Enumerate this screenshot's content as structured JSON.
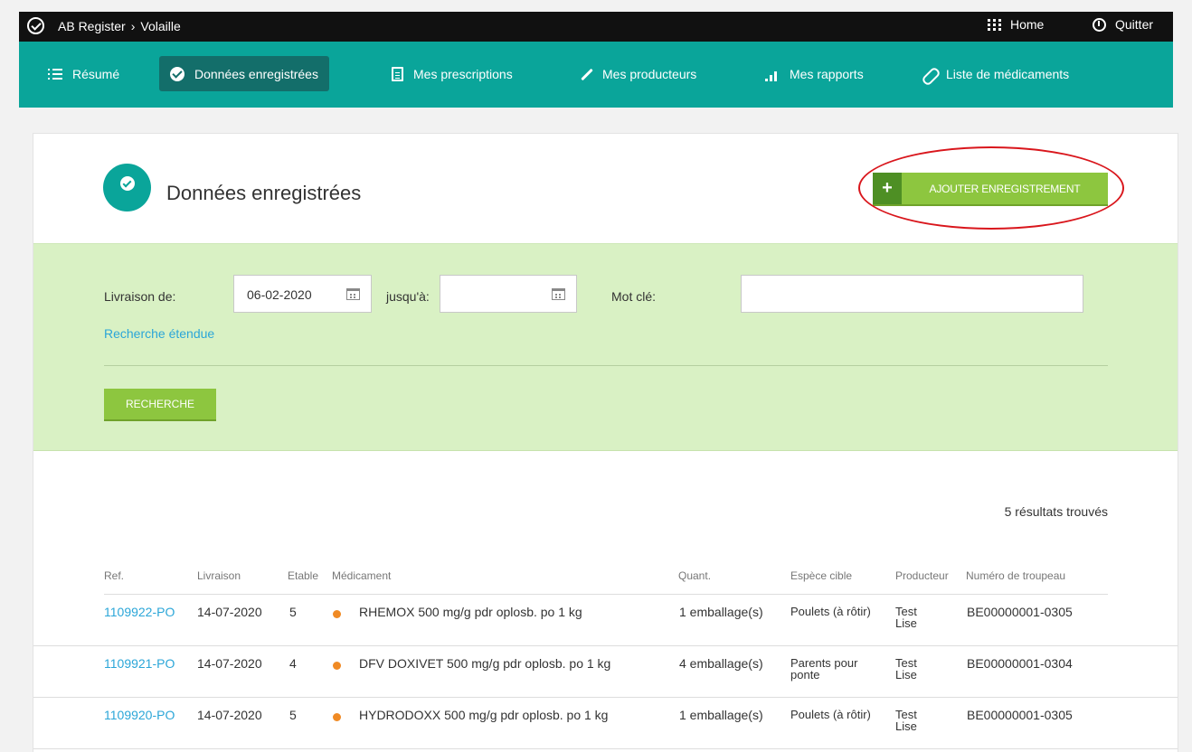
{
  "topbar": {
    "breadcrumb_app": "AB Register",
    "breadcrumb_separator": "›",
    "breadcrumb_page": "Volaille",
    "home_label": "Home",
    "quit_label": "Quitter"
  },
  "nav": {
    "items": [
      {
        "label": "Résumé",
        "icon": "list-icon"
      },
      {
        "label": "Données enregistrées",
        "icon": "check-circle-icon",
        "active": true
      },
      {
        "label": "Mes prescriptions",
        "icon": "document-icon"
      },
      {
        "label": "Mes producteurs",
        "icon": "syringe-icon"
      },
      {
        "label": "Mes rapports",
        "icon": "bar-chart-icon"
      },
      {
        "label": "Liste de médicaments",
        "icon": "pill-icon"
      }
    ]
  },
  "page": {
    "title": "Données enregistrées",
    "add_button_label": "AJOUTER ENREGISTREMENT",
    "add_button_icon": "+"
  },
  "filter": {
    "delivery_from_label": "Livraison de:",
    "delivery_from_value": "06-02-2020",
    "until_label": "jusqu'à:",
    "until_value": "",
    "keyword_label": "Mot clé:",
    "keyword_value": "",
    "extended_search_label": "Recherche étendue",
    "search_button_label": "RECHERCHE"
  },
  "results": {
    "count_text": "5 résultats trouvés",
    "columns": [
      "Ref.",
      "Livraison",
      "Etable",
      "Médicament",
      "Quant.",
      "Espèce cible",
      "Producteur",
      "Numéro de troupeau"
    ],
    "rows": [
      {
        "ref": "1109922-PO",
        "livraison": "14-07-2020",
        "etable": "5",
        "medicament": "RHEMOX 500 mg/g pdr oplosb. po 1 kg",
        "quant": "1 emballage(s)",
        "espece": "Poulets (à rôtir)",
        "producteur": "Test Lise",
        "troupeau": "BE00000001-0305"
      },
      {
        "ref": "1109921-PO",
        "livraison": "14-07-2020",
        "etable": "4",
        "medicament": "DFV DOXIVET 500 mg/g pdr oplosb. po 1 kg",
        "quant": "4 emballage(s)",
        "espece": "Parents pour ponte",
        "producteur": "Test Lise",
        "troupeau": "BE00000001-0304"
      },
      {
        "ref": "1109920-PO",
        "livraison": "14-07-2020",
        "etable": "5",
        "medicament": "HYDRODOXX 500 mg/g pdr oplosb. po 1 kg",
        "quant": "1 emballage(s)",
        "espece": "Poulets (à rôtir)",
        "producteur": "Test Lise",
        "troupeau": "BE00000001-0305"
      }
    ]
  },
  "colors": {
    "teal": "#0aa59a",
    "teal_dark": "#136e6a",
    "green_button": "#8dc63f",
    "filter_bg": "#d9f1c4",
    "link": "#2ba6d8",
    "status_dot": "#f08a24",
    "annotation": "#d9161c"
  }
}
